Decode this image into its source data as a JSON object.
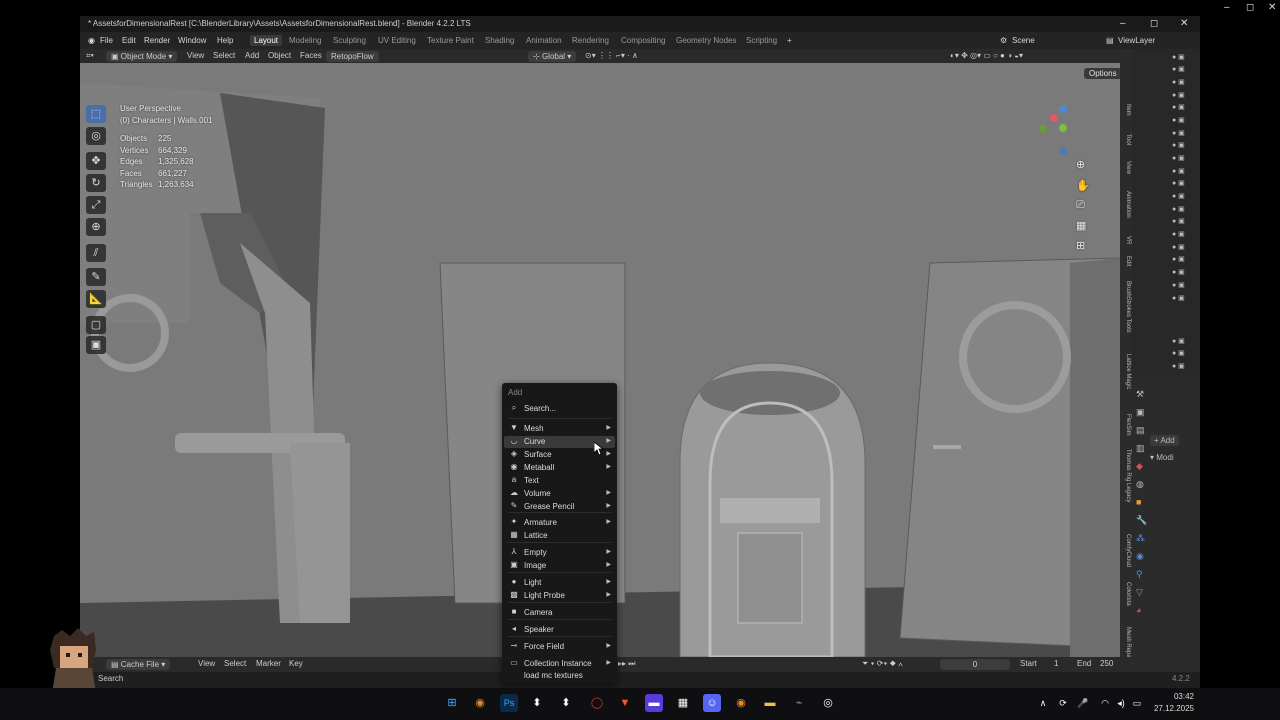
{
  "window": {
    "title": "* AssetsforDimensionalRest [C:\\BlenderLibrary\\Assets\\AssetsforDimensionalRest.blend] - Blender 4.2.2 LTS"
  },
  "menubar": {
    "menus": [
      "File",
      "Edit",
      "Render",
      "Window",
      "Help"
    ],
    "workspaces": [
      "Layout",
      "Modeling",
      "Sculpting",
      "UV Editing",
      "Texture Paint",
      "Shading",
      "Animation",
      "Rendering",
      "Compositing",
      "Geometry Nodes",
      "Scripting"
    ],
    "active_workspace": "Layout",
    "add_workspace": "+",
    "scene": "Scene",
    "view_layer": "ViewLayer"
  },
  "header3d": {
    "mode": "Object Mode",
    "menus": [
      "View",
      "Select",
      "Add",
      "Object",
      "Faces",
      "RetopoFlow"
    ],
    "orientation": "Global",
    "options": "Options"
  },
  "viewport": {
    "perspective": "User Perspective",
    "collection": "(0) Characters | Walls.001",
    "stats": [
      {
        "label": "Objects",
        "value": "225"
      },
      {
        "label": "Vertices",
        "value": "664,329"
      },
      {
        "label": "Edges",
        "value": "1,325,628"
      },
      {
        "label": "Faces",
        "value": "661,227"
      },
      {
        "label": "Triangles",
        "value": "1,263,634"
      }
    ]
  },
  "add_menu": {
    "title": "Add",
    "search": "Search...",
    "items": [
      {
        "label": "Mesh",
        "icon": "mesh-icon",
        "glyph": "▼",
        "submenu": true
      },
      {
        "label": "Curve",
        "icon": "curve-icon",
        "glyph": "◡",
        "submenu": true,
        "highlight": true
      },
      {
        "label": "Surface",
        "icon": "surface-icon",
        "glyph": "◈",
        "submenu": true
      },
      {
        "label": "Metaball",
        "icon": "metaball-icon",
        "glyph": "◉",
        "submenu": true
      },
      {
        "label": "Text",
        "icon": "text-icon",
        "glyph": "a",
        "submenu": false
      },
      {
        "label": "Volume",
        "icon": "volume-icon",
        "glyph": "☁",
        "submenu": true
      },
      {
        "label": "Grease Pencil",
        "icon": "grease-pencil-icon",
        "glyph": "✎",
        "submenu": true
      },
      {
        "label": "Armature",
        "icon": "armature-icon",
        "glyph": "✦",
        "submenu": true
      },
      {
        "label": "Lattice",
        "icon": "lattice-icon",
        "glyph": "▦",
        "submenu": false
      },
      {
        "label": "Empty",
        "icon": "empty-icon",
        "glyph": "⅄",
        "submenu": true
      },
      {
        "label": "Image",
        "icon": "image-icon",
        "glyph": "▣",
        "submenu": true
      },
      {
        "label": "Light",
        "icon": "light-icon",
        "glyph": "●",
        "submenu": true
      },
      {
        "label": "Light Probe",
        "icon": "light-probe-icon",
        "glyph": "▩",
        "submenu": true
      },
      {
        "label": "Camera",
        "icon": "camera-icon",
        "glyph": "■",
        "submenu": false
      },
      {
        "label": "Speaker",
        "icon": "speaker-icon",
        "glyph": "◂",
        "submenu": false
      },
      {
        "label": "Force Field",
        "icon": "force-field-icon",
        "glyph": "⊸",
        "submenu": true
      },
      {
        "label": "Collection Instance",
        "icon": "collection-instance-icon",
        "glyph": "▭",
        "submenu": true
      },
      {
        "label": "load mc textures",
        "icon": "",
        "glyph": "",
        "submenu": false
      }
    ]
  },
  "npanel_tabs": [
    "Item",
    "Tool",
    "View",
    "Animation",
    "VR",
    "Edit",
    "BrushStrokes Tools",
    "Lattice Magic",
    "FlexSim",
    "Thomas Rig Legacy",
    "ComfyCloud",
    "Colorista",
    "Mesh Repair"
  ],
  "properties": {
    "add_modifier": "Add",
    "section": "Modi"
  },
  "timeline": {
    "editor": "Cache File",
    "menus": [
      "View",
      "Select",
      "Marker",
      "Key"
    ],
    "current_frame": "0",
    "start_label": "Start",
    "start": "1",
    "end_label": "End",
    "end": "250"
  },
  "statusbar": {
    "left": "Search",
    "version": "4.2.2"
  },
  "taskbar": {
    "time": "03:42",
    "date": "27.12.2025"
  },
  "colors": {
    "accent": "#4a6ea8",
    "viewport_bg": "#777777",
    "menu_bg": "#181818"
  }
}
